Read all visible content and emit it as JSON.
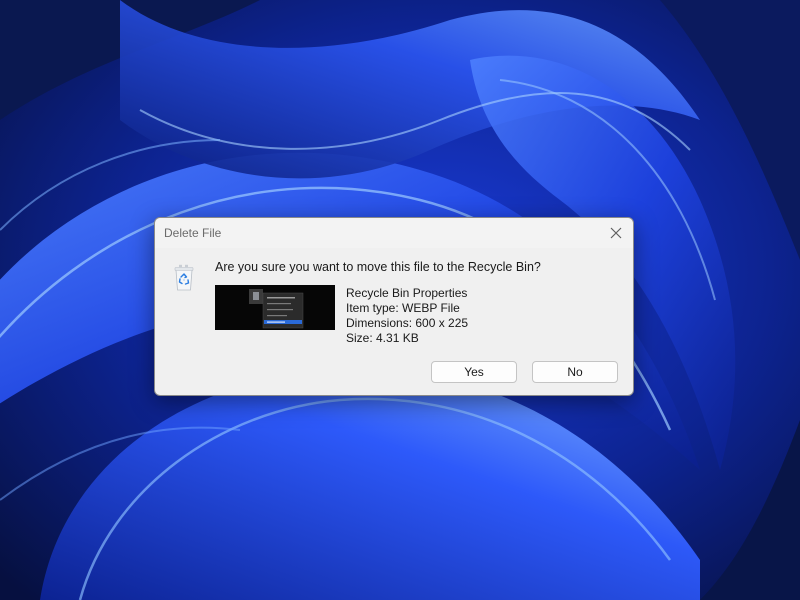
{
  "desktop": {
    "wallpaper": "windows-11-bloom-wallpaper",
    "colors": {
      "base": "#0a1a55",
      "accent": "#2a4fff",
      "highlight": "#7fb6ff"
    }
  },
  "dialog": {
    "title": "Delete File",
    "question": "Are you sure you want to move this file to the Recycle Bin?",
    "icon": "recycle-bin-icon",
    "close_icon": "close-icon",
    "file": {
      "name": "Recycle Bin Properties",
      "item_type": "Item type: WEBP File",
      "dimensions": "Dimensions: 600 x 225",
      "size": "Size: 4.31 KB"
    },
    "buttons": {
      "yes": "Yes",
      "no": "No"
    }
  }
}
